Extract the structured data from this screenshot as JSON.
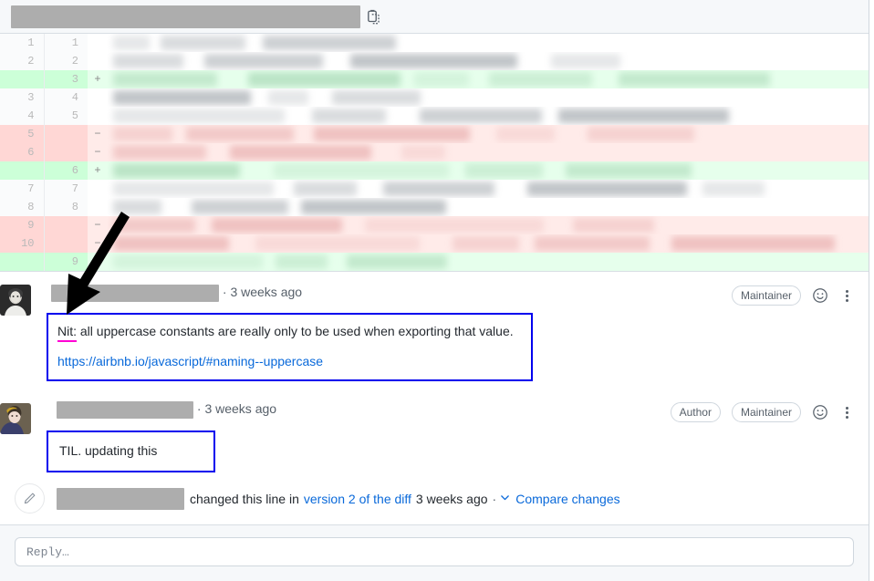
{
  "file_header": {
    "path_redacted": true,
    "copy_icon": "copy-clipboard-icon"
  },
  "diff": {
    "rows": [
      {
        "old": "1",
        "new": "1",
        "mark": "",
        "type": "ctx"
      },
      {
        "old": "2",
        "new": "2",
        "mark": "",
        "type": "ctx"
      },
      {
        "old": "",
        "new": "3",
        "mark": "+",
        "type": "add"
      },
      {
        "old": "3",
        "new": "4",
        "mark": "",
        "type": "ctx"
      },
      {
        "old": "4",
        "new": "5",
        "mark": "",
        "type": "ctx"
      },
      {
        "old": "5",
        "new": "",
        "mark": "−",
        "type": "del"
      },
      {
        "old": "6",
        "new": "",
        "mark": "−",
        "type": "del"
      },
      {
        "old": "",
        "new": "6",
        "mark": "+",
        "type": "add"
      },
      {
        "old": "7",
        "new": "7",
        "mark": "",
        "type": "ctx"
      },
      {
        "old": "8",
        "new": "8",
        "mark": "",
        "type": "ctx"
      },
      {
        "old": "9",
        "new": "",
        "mark": "−",
        "type": "del"
      },
      {
        "old": "10",
        "new": "",
        "mark": "−",
        "type": "del"
      },
      {
        "old": "",
        "new": "9",
        "mark": "+",
        "type": "add"
      }
    ]
  },
  "comments": [
    {
      "avatar": "user-avatar-portrait",
      "author_redacted": true,
      "separator": "·",
      "timestamp": "3 weeks ago",
      "badges": [
        "Maintainer"
      ],
      "reaction_icon": "smiley-reaction-icon",
      "menu_icon": "kebab-menu-icon",
      "body_prefix": "Nit:",
      "body_text": " all uppercase constants are really only to be used when exporting that value.",
      "body_link": "https://airbnb.io/javascript/#naming--uppercase"
    },
    {
      "avatar": "user-avatar-portrait",
      "author_redacted": true,
      "separator": "·",
      "timestamp": "3 weeks ago",
      "badges": [
        "Author",
        "Maintainer"
      ],
      "reaction_icon": "smiley-reaction-icon",
      "menu_icon": "kebab-menu-icon",
      "body_text": "TIL. updating this"
    }
  ],
  "timeline": {
    "icon": "pencil-icon",
    "actor_redacted": true,
    "text_before": "changed this line in",
    "diff_version_link": "version 2 of the diff",
    "timestamp": "3 weeks ago",
    "separator": "·",
    "chevron_icon": "chevron-down-icon",
    "compare_link": "Compare changes"
  },
  "reply": {
    "placeholder": "Reply…"
  },
  "annotation": {
    "arrow_icon": "pointer-arrow-annotation",
    "arrow_color": "#000000",
    "highlight_box_color": "#0000ee",
    "nit_underline_color": "#ff00d4"
  },
  "colors": {
    "addition_bg": "#e6ffec",
    "deletion_bg": "#ffebe9",
    "addition_gutter": "#ccffd8",
    "deletion_gutter": "#ffd7d5",
    "link": "#0969da",
    "muted": "#57606a",
    "header_bg": "#f6f8fa",
    "border": "#d8dee4"
  }
}
